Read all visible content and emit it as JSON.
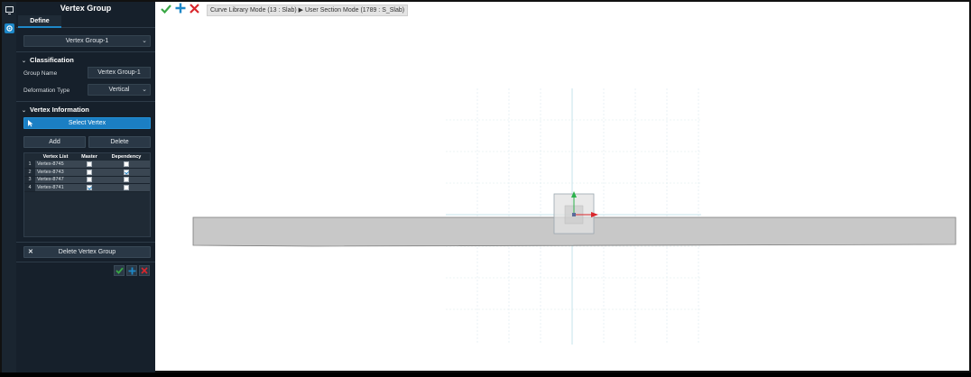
{
  "left_strip": {
    "icons": [
      "monitor-icon",
      "gear-icon"
    ]
  },
  "panel": {
    "title": "Vertex Group",
    "tab": "Define",
    "group_select": "Vertex Group-1",
    "classification": {
      "heading": "Classification",
      "group_name_label": "Group Name",
      "group_name_value": "Vertex Group-1",
      "deformation_label": "Deformation Type",
      "deformation_value": "Vertical"
    },
    "vertex_info": {
      "heading": "Vertex Information",
      "select_vertex": "Select Vertex",
      "add": "Add",
      "delete": "Delete",
      "columns": [
        "Vertex List",
        "Master",
        "Dependency"
      ],
      "rows": [
        {
          "n": "1",
          "name": "Vertex-8745",
          "master": false,
          "dependency": false
        },
        {
          "n": "2",
          "name": "Vertex-8743",
          "master": false,
          "dependency": true
        },
        {
          "n": "3",
          "name": "Vertex-8747",
          "master": false,
          "dependency": false
        },
        {
          "n": "4",
          "name": "Vertex-8741",
          "master": true,
          "dependency": false
        }
      ]
    },
    "delete_group": "Delete Vertex Group"
  },
  "toolbar": {
    "breadcrumb": "Curve Library Mode (13 : Slab) ▶ User Section Mode (1789 : S_Slab)",
    "colors": {
      "check": "#39a845",
      "plus": "#1e88c8",
      "x": "#d9262c"
    }
  }
}
